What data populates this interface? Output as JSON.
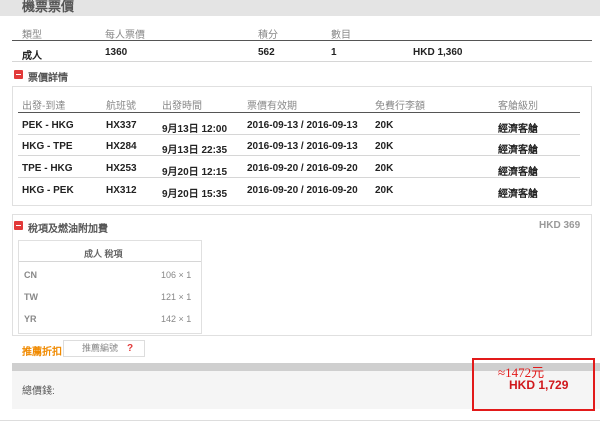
{
  "header": {
    "title": "機票票價"
  },
  "price_table": {
    "headers": [
      "類型",
      "每人票價",
      "積分",
      "數目"
    ],
    "row": {
      "type": "成人",
      "fare": "1360",
      "points": "562",
      "count": "1",
      "total": "HKD 1,360"
    }
  },
  "fare_details": {
    "title": "票價詳情",
    "headers": [
      "出發-到達",
      "航班號",
      "出發時間",
      "票價有效期",
      "免費行李額",
      "客艙級別"
    ],
    "rows": [
      {
        "route": "PEK - HKG",
        "flight": "HX337",
        "time": "9月13日 12:00",
        "validity": "2016-09-13 / 2016-09-13",
        "baggage": "20K",
        "cabin": "經濟客艙"
      },
      {
        "route": "HKG - TPE",
        "flight": "HX284",
        "time": "9月13日 22:35",
        "validity": "2016-09-13 / 2016-09-13",
        "baggage": "20K",
        "cabin": "經濟客艙"
      },
      {
        "route": "TPE - HKG",
        "flight": "HX253",
        "time": "9月20日 12:15",
        "validity": "2016-09-20 / 2016-09-20",
        "baggage": "20K",
        "cabin": "經濟客艙"
      },
      {
        "route": "HKG - PEK",
        "flight": "HX312",
        "time": "9月20日 15:35",
        "validity": "2016-09-20 / 2016-09-20",
        "baggage": "20K",
        "cabin": "經濟客艙"
      }
    ]
  },
  "taxes": {
    "title": "稅項及燃油附加費",
    "total": "HKD 369",
    "sub_title": "成人 稅項",
    "items": [
      {
        "code": "CN",
        "value": "106 × 1"
      },
      {
        "code": "TW",
        "value": "121 × 1"
      },
      {
        "code": "YR",
        "value": "142 × 1"
      }
    ]
  },
  "promo": {
    "label": "推薦折扣",
    "placeholder": "推薦編號",
    "help": "?"
  },
  "total": {
    "label": "總價錢:",
    "approx": "≈1472元",
    "amount": "HKD 1,729"
  },
  "colors": {
    "accent_red": "#e23a3a",
    "promo_orange": "#f08a00",
    "highlight_red": "#e21a1a"
  }
}
